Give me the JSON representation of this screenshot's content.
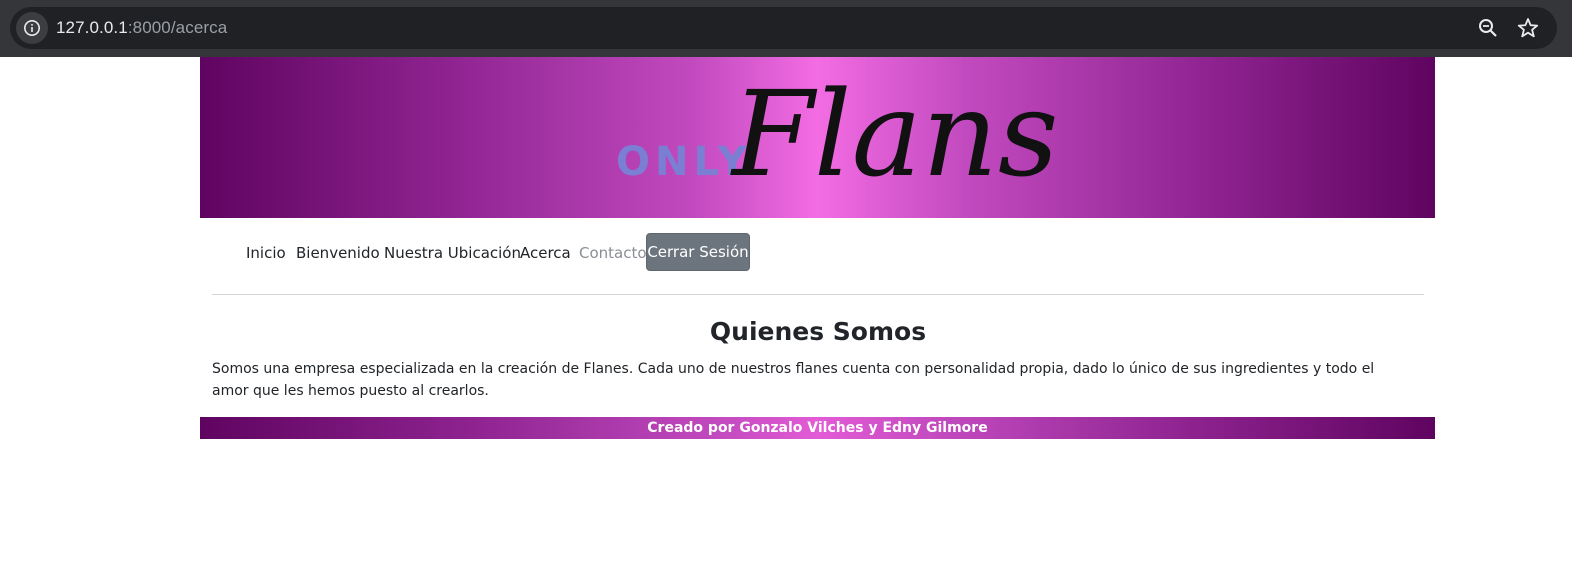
{
  "browser": {
    "url_host": "127.0.0.1",
    "url_path": ":8000/acerca",
    "icons": [
      "info-icon",
      "zoom-icon",
      "star-icon"
    ]
  },
  "banner": {
    "logo_small": "ONLY",
    "logo_script": "Flans"
  },
  "nav": {
    "items": [
      {
        "label": "Inicio"
      },
      {
        "label": "Bienvenido"
      },
      {
        "label": "Nuestra Ubicación"
      },
      {
        "label": "Acerca"
      },
      {
        "label": "Contacto"
      }
    ],
    "logout_label": "Cerrar Sesión"
  },
  "main": {
    "title": "Quienes Somos",
    "body": "Somos una empresa especializada en la creación de Flanes. Cada uno de nuestros flanes cuenta con personalidad propia, dado lo único de sus ingredientes y todo el amor que les hemos puesto al crearlos."
  },
  "footer": {
    "text": "Creado por Gonzalo Vilches y Edny Gilmore"
  },
  "colors": {
    "banner_dark": "#5f0460",
    "banner_light": "#f36ce3",
    "only_blue": "#7b7fd4",
    "button_gray": "#6c757d"
  }
}
